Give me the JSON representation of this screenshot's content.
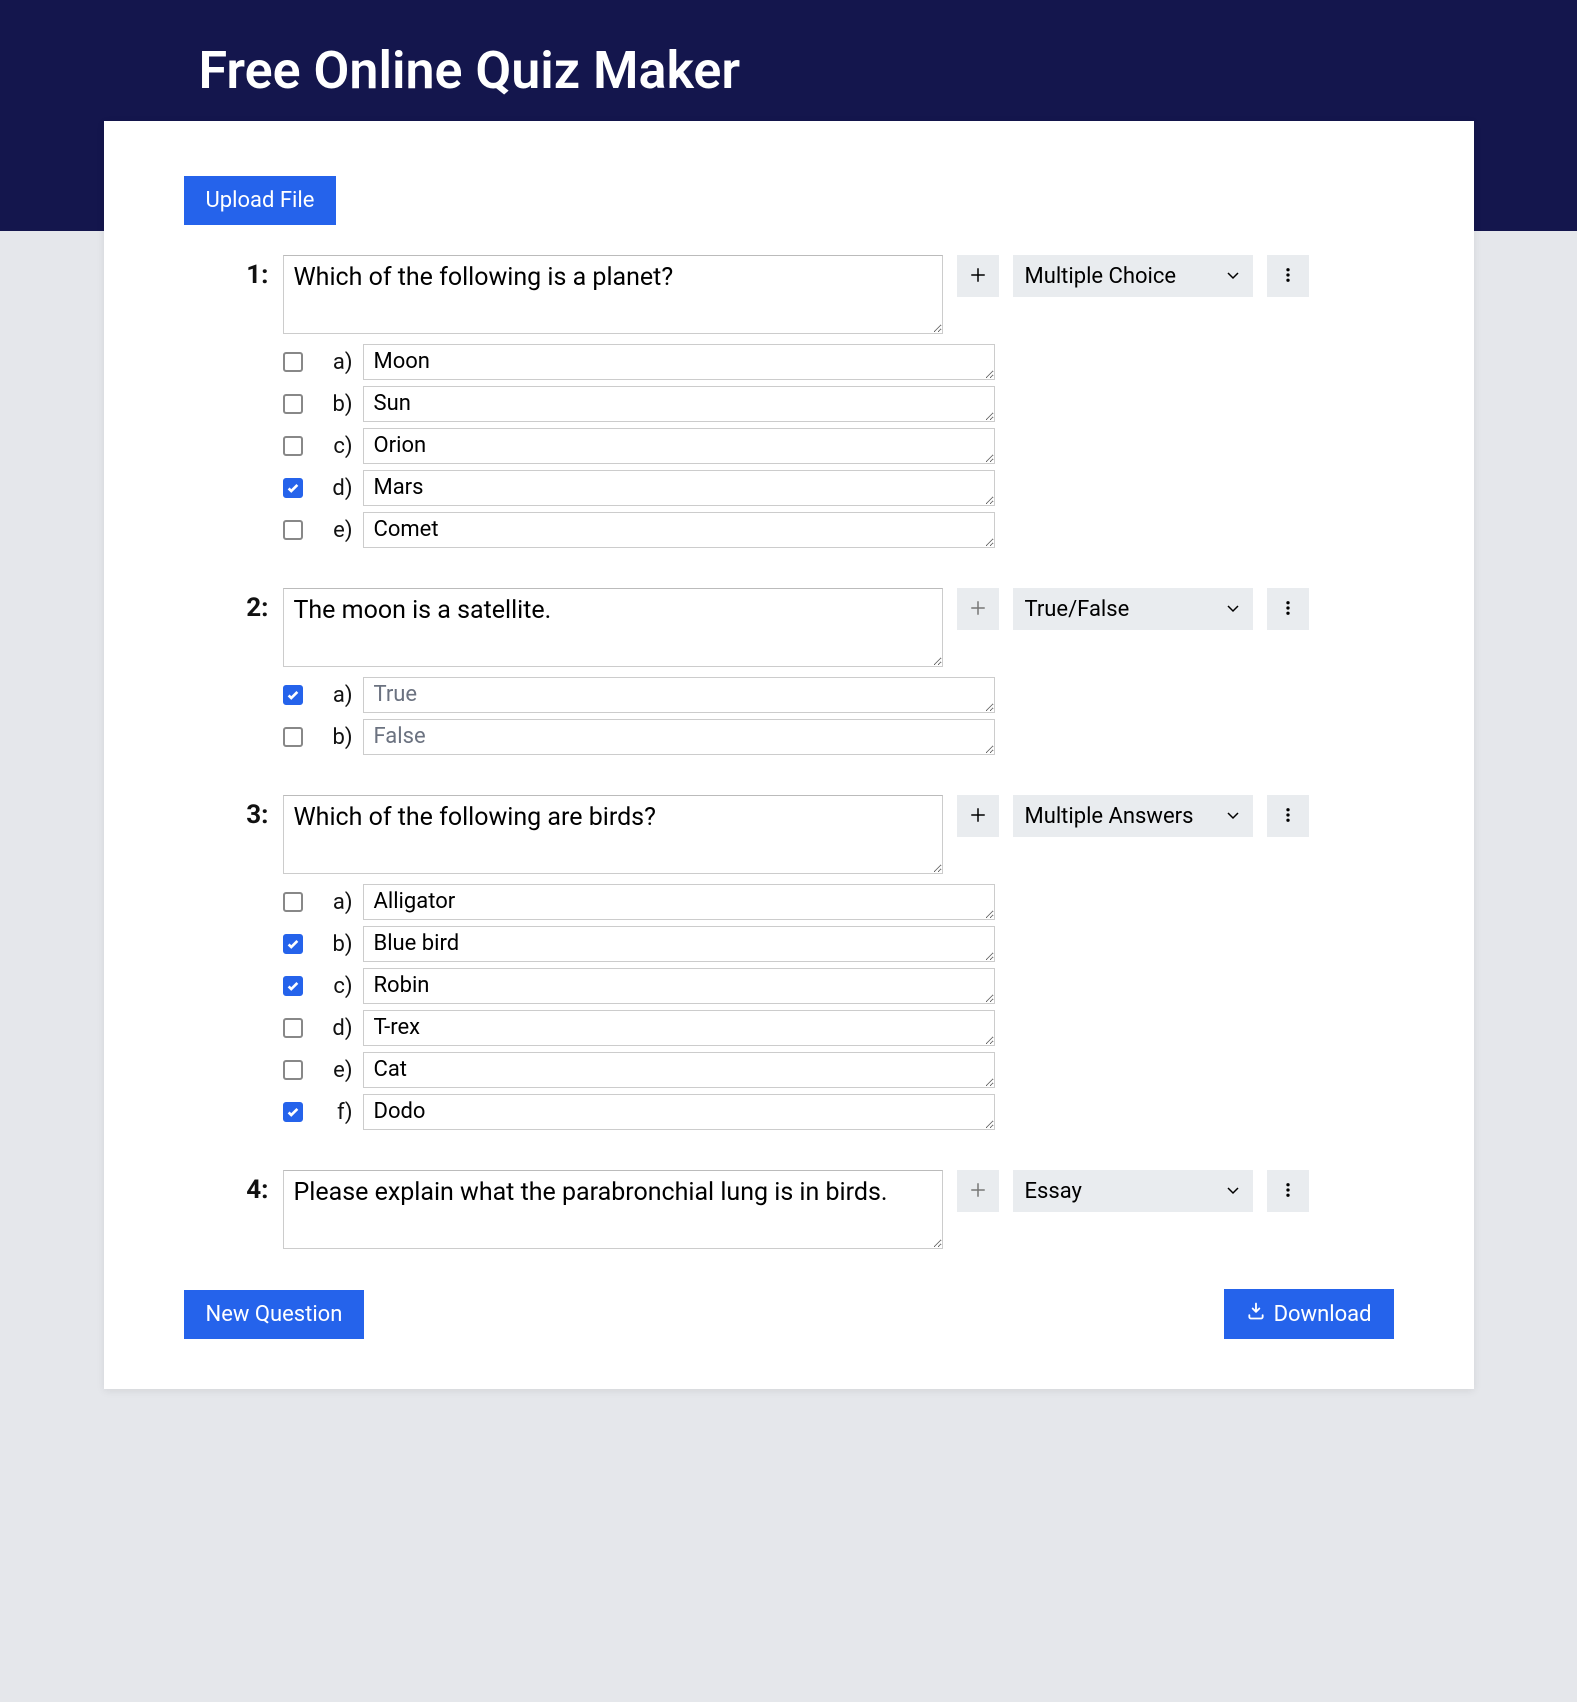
{
  "page_title": "Free Online Quiz Maker",
  "buttons": {
    "upload": "Upload File",
    "new_question": "New Question",
    "download": "Download"
  },
  "question_types": [
    "Multiple Choice",
    "True/False",
    "Multiple Answers",
    "Essay"
  ],
  "questions": [
    {
      "number": "1:",
      "text": "Which of the following is a planet?",
      "type": "Multiple Choice",
      "add_enabled": true,
      "answers": [
        {
          "letter": "a)",
          "text": "Moon",
          "checked": false,
          "readonly": false
        },
        {
          "letter": "b)",
          "text": "Sun",
          "checked": false,
          "readonly": false
        },
        {
          "letter": "c)",
          "text": "Orion",
          "checked": false,
          "readonly": false
        },
        {
          "letter": "d)",
          "text": "Mars",
          "checked": true,
          "readonly": false
        },
        {
          "letter": "e)",
          "text": "Comet",
          "checked": false,
          "readonly": false
        }
      ]
    },
    {
      "number": "2:",
      "text": "The moon is a satellite.",
      "type": "True/False",
      "add_enabled": false,
      "answers": [
        {
          "letter": "a)",
          "text": "True",
          "checked": true,
          "readonly": true
        },
        {
          "letter": "b)",
          "text": "False",
          "checked": false,
          "readonly": true
        }
      ]
    },
    {
      "number": "3:",
      "text": "Which of the following are birds?",
      "type": "Multiple Answers",
      "add_enabled": true,
      "answers": [
        {
          "letter": "a)",
          "text": "Alligator",
          "checked": false,
          "readonly": false
        },
        {
          "letter": "b)",
          "text": "Blue bird",
          "checked": true,
          "readonly": false
        },
        {
          "letter": "c)",
          "text": "Robin",
          "checked": true,
          "readonly": false
        },
        {
          "letter": "d)",
          "text": "T-rex",
          "checked": false,
          "readonly": false
        },
        {
          "letter": "e)",
          "text": "Cat",
          "checked": false,
          "readonly": false
        },
        {
          "letter": "f)",
          "text": "Dodo",
          "checked": true,
          "readonly": false
        }
      ]
    },
    {
      "number": "4:",
      "text": "Please explain what the parabronchial lung is in birds.",
      "type": "Essay",
      "add_enabled": false,
      "answers": []
    }
  ]
}
